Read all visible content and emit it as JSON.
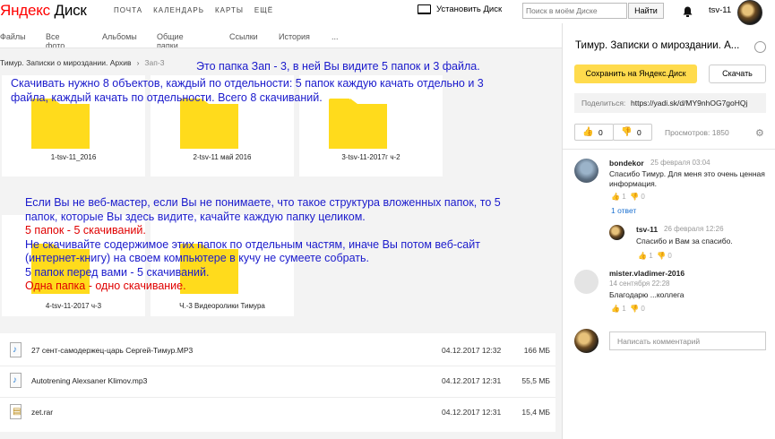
{
  "header": {
    "logo_ya": "Яндекс",
    "logo_disk": "Диск",
    "nav": [
      "ПОЧТА",
      "КАЛЕНДАРЬ",
      "КАРТЫ",
      "ЕЩЁ"
    ],
    "install_label": "Установить Диск",
    "search_placeholder": "Поиск в моём Диске",
    "find_label": "Найти",
    "username": "tsv-11"
  },
  "subnav": [
    "Файлы",
    "Все фото",
    "Альбомы",
    "Общие папки",
    "Ссылки",
    "История",
    "..."
  ],
  "breadcrumb": {
    "parent": "Тимур. Записки о мироздании. Архив",
    "current": "Зап-3"
  },
  "folders": [
    {
      "name": "1-tsv-11_2016"
    },
    {
      "name": "2-tsv-11 май 2016"
    },
    {
      "name": "3-tsv-11-2017г ч-2"
    },
    {
      "name": "4-tsv-11-2017 ч-3"
    },
    {
      "name": "Ч.-3 Видеоролики Тимура"
    }
  ],
  "notes": {
    "n1": "Это папка Зап - 3, в ней Вы видите 5 папок и 3 файла.",
    "n2": "Скачивать нужно 8 объектов, каждый по отдельности: 5 папок каждую качать отдельно и 3 файла, каждый качать по отдельности. Всего 8 скачиваний.",
    "n3_a": "Если Вы не веб-мастер, если Вы не понимаете, что такое структура вложенных папок, то 5 папок, которые Вы здесь видите, качайте каждую папку целиком.",
    "n3_red1": "5 папок - 5 скачиваний.",
    "n3_b": "Не скачивайте содержимое этих папок по отдельным частям, иначе Вы потом веб-сайт (интернет-книгу) на своем компьютере в кучу не сумеете собрать.",
    "n3_c": "5 папок перед вами - 5 скачиваний.",
    "n3_red2": "Одна папка - одно скачивание."
  },
  "files": [
    {
      "name": "27 сент-самодержец-царь Сергей-Тимур.MP3",
      "date": "04.12.2017 12:32",
      "size": "166 МБ",
      "icon": "audio-file-icon"
    },
    {
      "name": "Autotrening Alexsaner Klimov.mp3",
      "date": "04.12.2017 12:31",
      "size": "55,5 МБ",
      "icon": "audio-file-icon"
    },
    {
      "name": "zet.rar",
      "date": "04.12.2017 12:31",
      "size": "15,4 МБ",
      "icon": "archive-file-icon"
    }
  ],
  "panel": {
    "title": "Тимур. Записки о мироздании. А...",
    "save_label": "Сохранить на Яндекс.Диск",
    "download_label": "Скачать",
    "share_label": "Поделиться:",
    "share_link": "https://yadi.sk/d/MY9nhOG7goHQj",
    "likes": "0",
    "dislikes": "0",
    "views": "Просмотров: 1850"
  },
  "comments": [
    {
      "author": "bondekor",
      "date": "25 февраля 03:04",
      "text": "Спасибо Тимур. Для меня это очень ценная информация.",
      "up": "1",
      "down": "0",
      "reply": "1 ответ"
    },
    {
      "author": "tsv-11",
      "date": "26 февраля 12:26",
      "text": "Спасибо и Вам за спасибо.",
      "up": "1",
      "down": "0"
    },
    {
      "author": "mister.vladimer-2016",
      "date": "14 сентября 22:28",
      "text": "Благодарю ...коллега",
      "up": "1",
      "down": "0"
    }
  ],
  "comment_placeholder": "Написать комментарий"
}
